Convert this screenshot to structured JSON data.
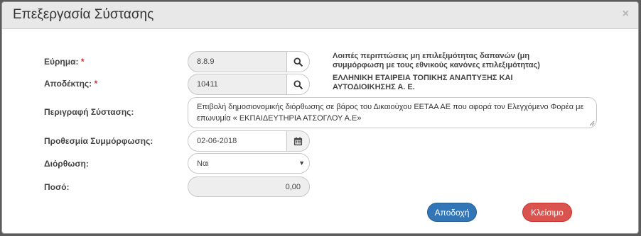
{
  "modal": {
    "title": "Επεξεργασία Σύστασης",
    "close_symbol": "×"
  },
  "form": {
    "finding": {
      "label": "Εύρημα:",
      "required_mark": "*",
      "value": "8.8.9",
      "button_icon": "search-icon"
    },
    "recipient": {
      "label": "Αποδέκτης:",
      "required_mark": "*",
      "value": "10411",
      "button_icon": "search-icon"
    },
    "description": {
      "label": "Περιγραφή Σύστασης:",
      "value": "Επιβολή δημοσιονομικής διόρθωσης σε βάρος του Δικαιούχου ΕΕΤΑΑ ΑΕ που αφορά τον Ελεγχόμενο Φορέα με επωνυμία « ΕΚΠΑΙΔΕΥΤΗΡΙΑ ΑΤΣΟΓΛΟΥ Α.Ε»"
    },
    "deadline": {
      "label": "Προθεσμία Συμμόρφωσης:",
      "value": "02-06-2018",
      "button_icon": "calendar-icon"
    },
    "correction": {
      "label": "Διόρθωση:",
      "value": "Ναι"
    },
    "amount": {
      "label": "Ποσό:",
      "value": "0,00"
    }
  },
  "info": {
    "finding_desc": "Λοιπές περιπτώσεις μη επιλεξιμότητας δαπανών (μη συμμόρφωση με τους εθνικούς κανόνες επιλεξιμότητας)",
    "recipient_desc": "ΕΛΛΗΝΙΚΗ ΕΤΑΙΡΕΙΑ ΤΟΠΙΚΗΣ ΑΝΑΠΤΥΞΗΣ ΚΑΙ ΑΥΤΟΔΙΟΙΚΗΣΗΣ Α. Ε."
  },
  "buttons": {
    "accept": "Αποδοχή",
    "close": "Κλείσιμο"
  },
  "colors": {
    "primary": "#3276b8",
    "danger": "#d9534f",
    "required": "#c9302c"
  }
}
